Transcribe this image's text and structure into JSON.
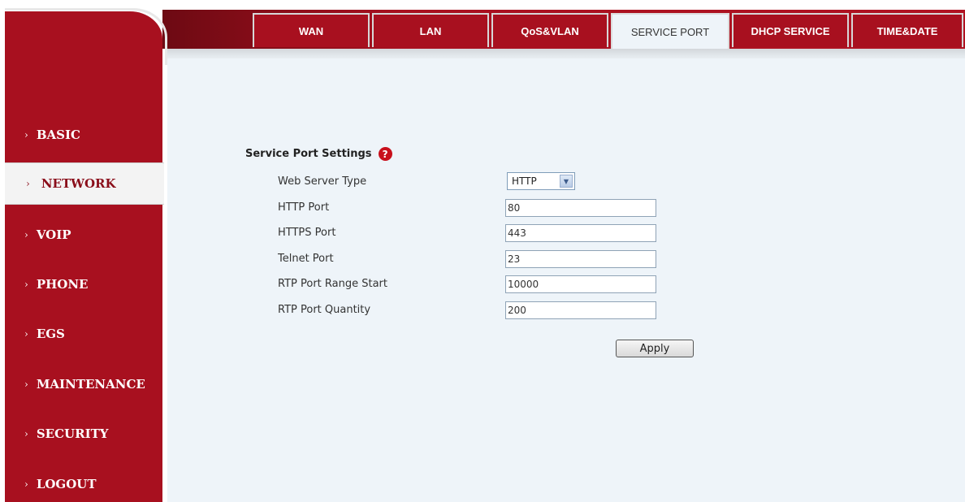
{
  "tabs": [
    {
      "label": "WAN",
      "active": false
    },
    {
      "label": "LAN",
      "active": false
    },
    {
      "label": "QoS&VLAN",
      "active": false
    },
    {
      "label": "SERVICE PORT",
      "active": true
    },
    {
      "label": "DHCP SERVICE",
      "active": false
    },
    {
      "label": "TIME&DATE",
      "active": false
    }
  ],
  "sidebar": {
    "items": [
      {
        "label": "BASIC",
        "active": false
      },
      {
        "label": "NETWORK",
        "active": true
      },
      {
        "label": "VOIP",
        "active": false
      },
      {
        "label": "PHONE",
        "active": false
      },
      {
        "label": "EGS",
        "active": false
      },
      {
        "label": "MAINTENANCE",
        "active": false
      },
      {
        "label": "SECURITY",
        "active": false
      },
      {
        "label": "LOGOUT",
        "active": false
      }
    ],
    "chevron": "›"
  },
  "section": {
    "title": "Service Port Settings",
    "help_icon": "?"
  },
  "form": {
    "web_server_type": {
      "label": "Web Server Type",
      "value": "HTTP"
    },
    "http_port": {
      "label": "HTTP Port",
      "value": "80"
    },
    "https_port": {
      "label": "HTTPS Port",
      "value": "443"
    },
    "telnet_port": {
      "label": "Telnet Port",
      "value": "23"
    },
    "rtp_start": {
      "label": "RTP Port Range Start",
      "value": "10000"
    },
    "rtp_quantity": {
      "label": "RTP Port Quantity",
      "value": "200"
    }
  },
  "apply_label": "Apply",
  "colors": {
    "brand_red": "#a8101f",
    "content_bg": "#eef4f9",
    "help_red": "#c8101c"
  }
}
